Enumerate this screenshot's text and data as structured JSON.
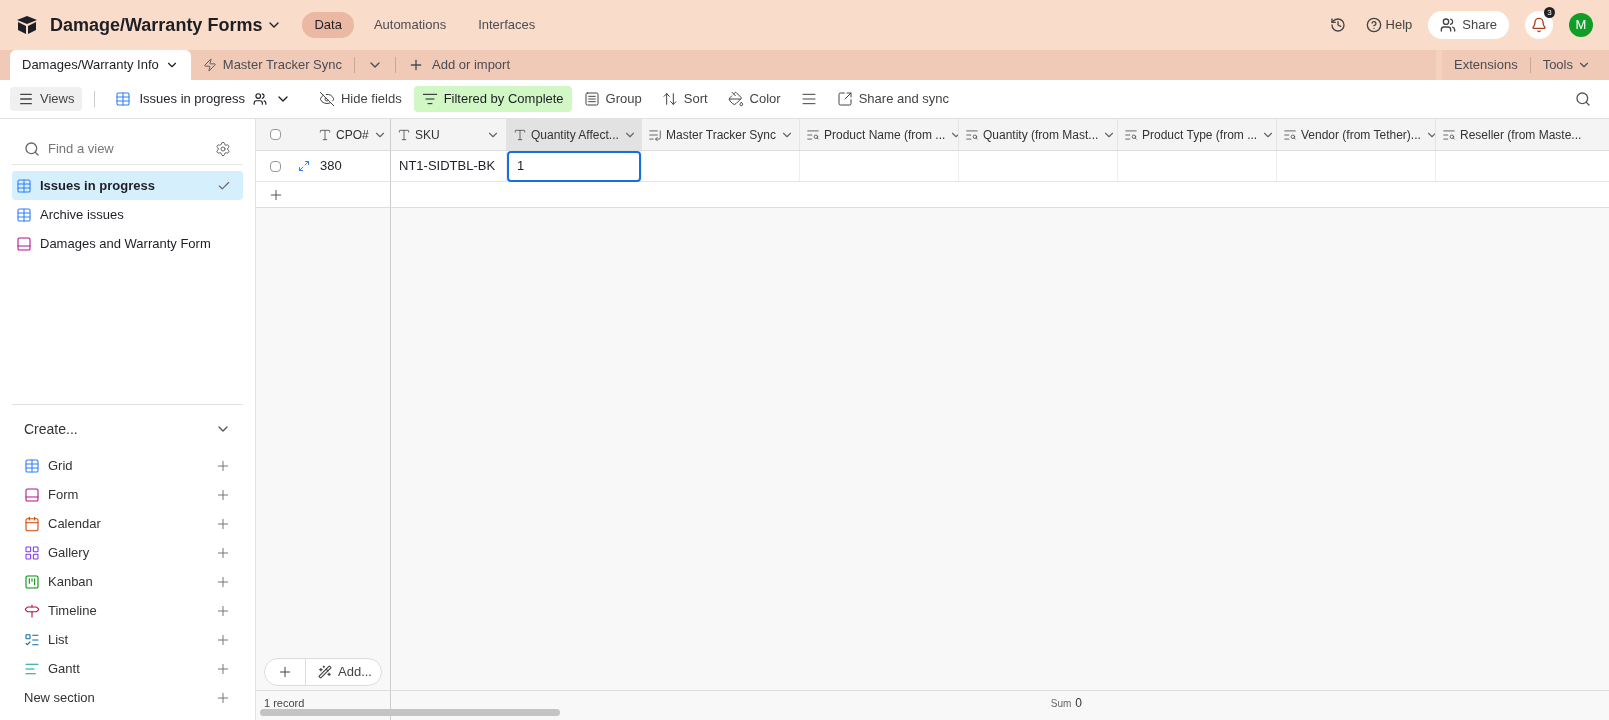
{
  "base": {
    "title": "Damage/Warranty Forms"
  },
  "nav": [
    {
      "label": "Data",
      "selected": true
    },
    {
      "label": "Automations",
      "selected": false
    },
    {
      "label": "Interfaces",
      "selected": false
    }
  ],
  "header_actions": {
    "help": "Help",
    "share": "Share",
    "notifications": "3",
    "avatar": "M"
  },
  "tables": [
    {
      "label": "Damages/Warranty Info",
      "selected": true
    },
    {
      "label": "Master Tracker Sync",
      "selected": false
    }
  ],
  "add_import": "Add or import",
  "extensions": "Extensions",
  "tools": "Tools",
  "toolbar": {
    "views": "Views",
    "current_view": "Issues in progress",
    "items": [
      {
        "kind": "hide",
        "label": "Hide fields",
        "active": false
      },
      {
        "kind": "filter",
        "label": "Filtered by Complete",
        "active": true
      },
      {
        "kind": "group",
        "label": "Group",
        "active": false
      },
      {
        "kind": "sort",
        "label": "Sort",
        "active": false
      },
      {
        "kind": "color",
        "label": "Color",
        "active": false
      },
      {
        "kind": "rowheight",
        "active": false
      },
      {
        "kind": "share",
        "label": "Share and sync",
        "active": false
      }
    ]
  },
  "sidebar": {
    "search_placeholder": "Find a view",
    "views": [
      {
        "label": "Issues in progress",
        "kind": "grid",
        "selected": true
      },
      {
        "label": "Archive issues",
        "kind": "grid",
        "selected": false
      },
      {
        "label": "Damages and Warranty Form",
        "kind": "form",
        "selected": false
      }
    ],
    "create_title": "Create...",
    "create_items": [
      {
        "label": "Grid",
        "kind": "grid"
      },
      {
        "label": "Form",
        "kind": "form"
      },
      {
        "label": "Calendar",
        "kind": "calendar"
      },
      {
        "label": "Gallery",
        "kind": "gallery"
      },
      {
        "label": "Kanban",
        "kind": "kanban"
      },
      {
        "label": "Timeline",
        "kind": "timeline"
      },
      {
        "label": "List",
        "kind": "list"
      },
      {
        "label": "Gantt",
        "kind": "gantt"
      }
    ],
    "new_section": "New section"
  },
  "grid": {
    "header_checkbox": {
      "checked": false
    },
    "columns": [
      {
        "label": "CPO#",
        "kind": "text",
        "selected": false
      },
      {
        "label": "SKU",
        "kind": "text",
        "selected": false
      },
      {
        "label": "Quantity Affect...",
        "kind": "text",
        "selected": true
      },
      {
        "label": "Master Tracker Sync",
        "kind": "link",
        "selected": false
      },
      {
        "label": "Product Name (from ...",
        "kind": "lookup",
        "selected": false
      },
      {
        "label": "Quantity (from Mast...",
        "kind": "lookup",
        "selected": false
      },
      {
        "label": "Product Type (from ...",
        "kind": "lookup",
        "selected": false
      },
      {
        "label": "Vendor (from Tether)...",
        "kind": "lookup",
        "selected": false
      },
      {
        "label": "Reseller (from Maste...",
        "kind": "lookup",
        "selected": false
      }
    ],
    "rows": [
      {
        "checked": false,
        "cells": [
          {
            "value": "380",
            "selected": false
          },
          {
            "value": "NT1-SIDTBL-BK",
            "selected": false
          },
          {
            "value": "1",
            "selected": true
          }
        ]
      }
    ],
    "add_label": "Add...",
    "record_count": "1 record",
    "summary": {
      "label": "Sum",
      "value": "0"
    }
  }
}
